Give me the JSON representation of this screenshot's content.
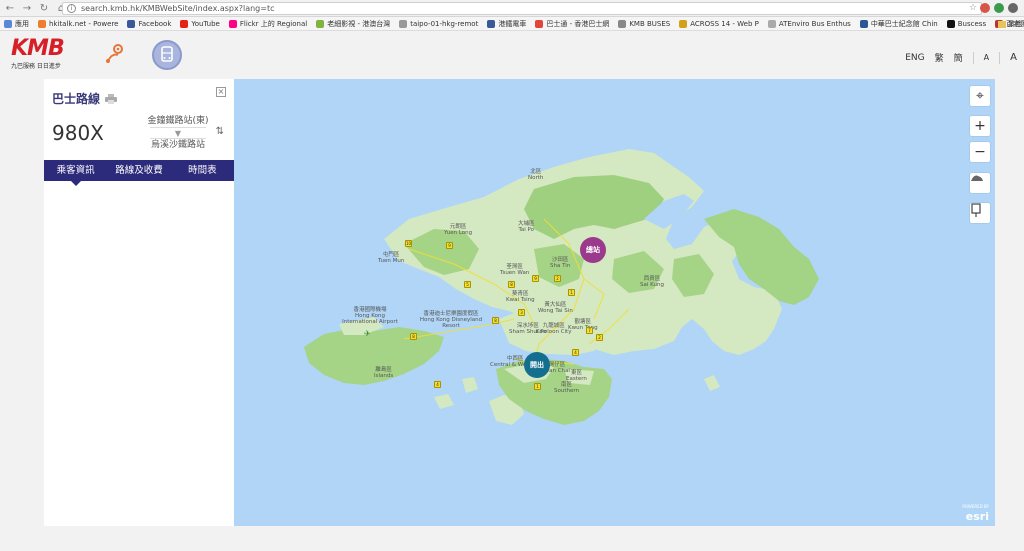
{
  "browser": {
    "url": "search.kmb.hk/KMBWebSite/index.aspx?lang=tc",
    "bookmarks": [
      {
        "label": "應用",
        "color": "#5a87d6"
      },
      {
        "label": "hkitalk.net - Powere",
        "color": "#f07c2e"
      },
      {
        "label": "Facebook",
        "color": "#3b5998"
      },
      {
        "label": "YouTube",
        "color": "#e62117"
      },
      {
        "label": "Flickr 上的 Regional",
        "color": "#ff0084"
      },
      {
        "label": "老細影視 - 港澳台灣",
        "color": "#7fb440"
      },
      {
        "label": "taipo-01-hkg-remot",
        "color": "#999999"
      },
      {
        "label": "港鐵電車",
        "color": "#3b5998"
      },
      {
        "label": "巴士通 - 香港巴士網",
        "color": "#e2453b"
      },
      {
        "label": "KMB BUSES",
        "color": "#888888"
      },
      {
        "label": "ACROSS 14 - Web P",
        "color": "#d4a017"
      },
      {
        "label": "ATEnviro Bus Enthus",
        "color": "#aaaaaa"
      },
      {
        "label": "中華巴士紀念館 Chin",
        "color": "#2b5797"
      },
      {
        "label": "Buscess",
        "color": "#111111"
      },
      {
        "label": "百老匯",
        "color": "#c9302c"
      }
    ],
    "bookmarks_more": "»",
    "other_bookmarks": "其他"
  },
  "header": {
    "logo_text": "KMB",
    "logo_tagline": "九巴服務 日日進步",
    "lang_en": "ENG",
    "lang_tc": "繁",
    "lang_sc": "簡",
    "font_small": "A",
    "font_large": "A"
  },
  "panel": {
    "title": "巴士路線",
    "route_number": "980X",
    "origin": "金鐘鐵路站(東)",
    "destination": "烏溪沙鐵路站",
    "tabs": [
      {
        "label": "乘客資訊",
        "active": true
      },
      {
        "label": "路線及收費",
        "active": false
      },
      {
        "label": "時間表",
        "active": false
      }
    ]
  },
  "map": {
    "origin_label": "開出",
    "destination_label": "總站",
    "places": [
      {
        "zh": "北區",
        "en": "North"
      },
      {
        "zh": "大埔區",
        "en": "Tai Po"
      },
      {
        "zh": "元朗區",
        "en": "Yuen Long"
      },
      {
        "zh": "屯門區",
        "en": "Tuen Mun"
      },
      {
        "zh": "荃灣區",
        "en": "Tsuen Wan"
      },
      {
        "zh": "沙田區",
        "en": "Sha Tin"
      },
      {
        "zh": "西貢區",
        "en": "Sai Kung"
      },
      {
        "zh": "葵青區",
        "en": "Kwai Tsing"
      },
      {
        "zh": "黃大仙區",
        "en": "Wong Tai Sin"
      },
      {
        "zh": "深水埗區",
        "en": "Sham Shui Po"
      },
      {
        "zh": "九龍城區",
        "en": "Kowloon City"
      },
      {
        "zh": "觀塘區",
        "en": "Kwun Tong"
      },
      {
        "zh": "香港國際機場",
        "en": "Hong Kong International Airport"
      },
      {
        "zh": "香港迪士尼樂園度假區",
        "en": "Hong Kong Disneyland Resort"
      },
      {
        "zh": "中西區",
        "en": "Central & Western"
      },
      {
        "zh": "灣仔區",
        "en": "Wan Chai"
      },
      {
        "zh": "東區",
        "en": "Eastern"
      },
      {
        "zh": "南區",
        "en": "Southern"
      },
      {
        "zh": "離島區",
        "en": "Islands"
      }
    ],
    "attribution_powered": "POWERED BY",
    "attribution": "esri"
  }
}
